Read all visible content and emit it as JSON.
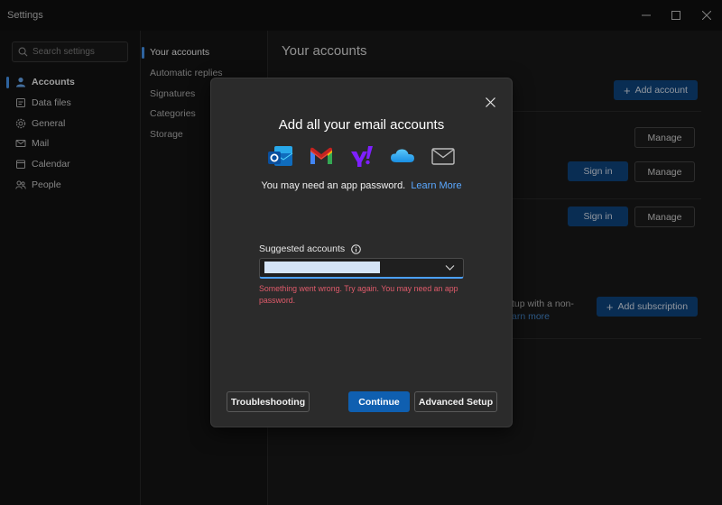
{
  "window": {
    "title": "Settings"
  },
  "search": {
    "placeholder": "Search settings"
  },
  "nav": {
    "items": [
      {
        "label": "Accounts",
        "icon": "person-icon",
        "active": true
      },
      {
        "label": "Data files",
        "icon": "data-file-icon",
        "active": false
      },
      {
        "label": "General",
        "icon": "gear-icon",
        "active": false
      },
      {
        "label": "Mail",
        "icon": "mail-icon",
        "active": false
      },
      {
        "label": "Calendar",
        "icon": "calendar-icon",
        "active": false
      },
      {
        "label": "People",
        "icon": "people-icon",
        "active": false
      }
    ]
  },
  "subnav": {
    "items": [
      {
        "label": "Your accounts",
        "active": true
      },
      {
        "label": "Automatic replies",
        "active": false
      },
      {
        "label": "Signatures",
        "active": false
      },
      {
        "label": "Categories",
        "active": false
      },
      {
        "label": "Storage",
        "active": false
      }
    ]
  },
  "content": {
    "heading": "Your accounts",
    "add_account": "Add account",
    "manage": "Manage",
    "sign_in": "Sign in",
    "subscription_text": "tup with a non-",
    "learn_more_partial": "arn more",
    "add_subscription": "Add subscription"
  },
  "dialog": {
    "title": "Add all your email accounts",
    "providers": [
      "outlook-icon",
      "gmail-icon",
      "yahoo-icon",
      "icloud-icon",
      "generic-mail-icon"
    ],
    "note": "You may need an app password.",
    "learn_more": "Learn More",
    "suggested_label": "Suggested accounts",
    "error": "Something went wrong. Try again. You may need an app password.",
    "troubleshooting": "Troubleshooting",
    "continue": "Continue",
    "advanced_setup": "Advanced Setup"
  },
  "colors": {
    "accent": "#4ba0ff",
    "primary_button": "#0f5fb0",
    "error": "#e05b6b",
    "link": "#5aa8ff"
  }
}
